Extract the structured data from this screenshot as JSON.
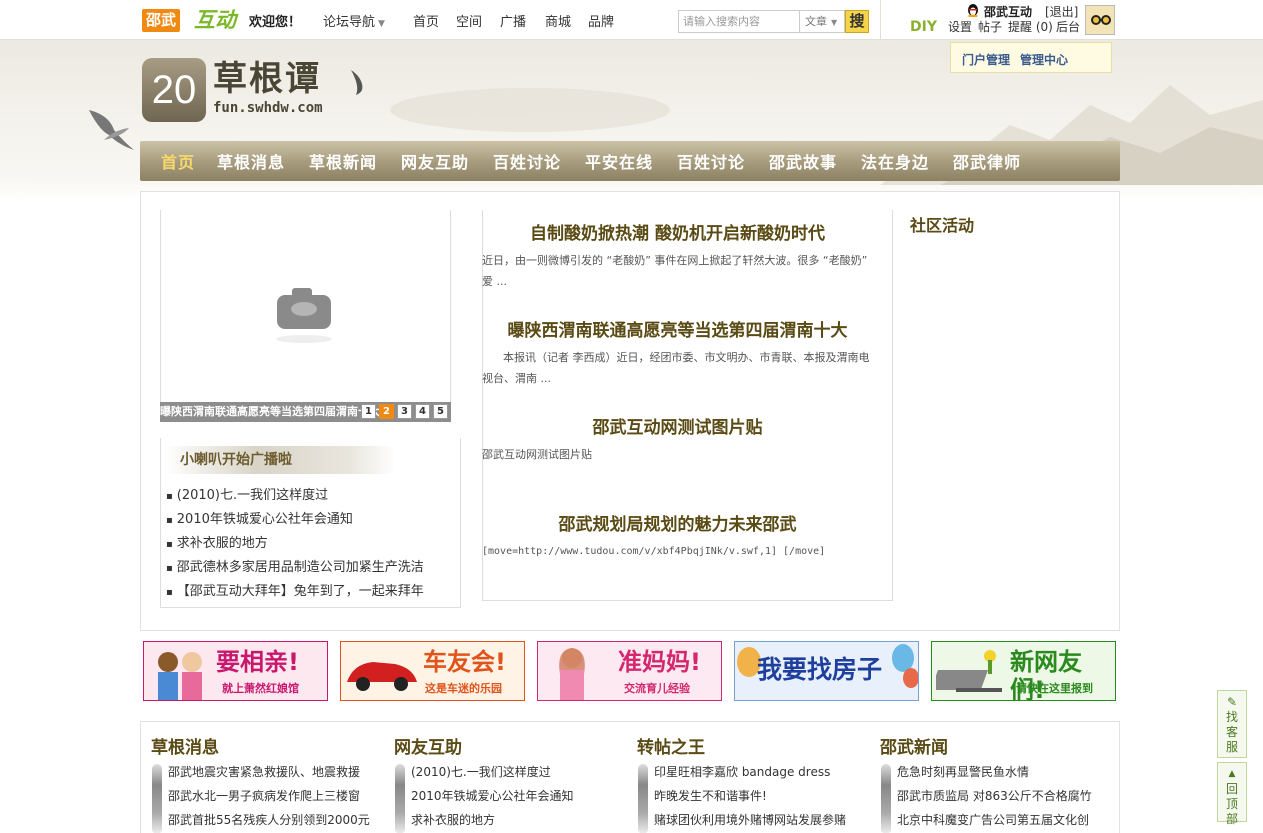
{
  "topbar": {
    "logo_a": "邵武",
    "logo_b": "互动",
    "welcome": "欢迎您！",
    "forum_nav": "论坛导航",
    "links": [
      "首页",
      "空间",
      "广播",
      "商城",
      "品牌"
    ],
    "search_placeholder": "请输入搜索内容",
    "search_type": "文章",
    "search_btn": "搜",
    "diy": "DIY",
    "username": "邵武互动",
    "logout": "[退出]",
    "user_links": [
      "设置",
      "帖子",
      "提醒 (0)",
      "后台"
    ]
  },
  "admin_popup": [
    "门户管理",
    "管理中心"
  ],
  "site": {
    "badge": "20",
    "name": "草根谭",
    "url": "fun.swhdw.com"
  },
  "nav": [
    "首页",
    "草根消息",
    "草根新闻",
    "网友互助",
    "百姓讨论",
    "平安在线",
    "百姓讨论",
    "邵武故事",
    "法在身边",
    "邵武律师"
  ],
  "slider": {
    "caption": "曝陕西渭南联通高愿亮等当选第四届渭南十大",
    "pages": [
      "1",
      "2",
      "3",
      "4",
      "5"
    ],
    "active_page": 2
  },
  "broadcast": {
    "title": "小喇叭开始广播啦",
    "items": [
      "(2010)七.一我们这样度过",
      "2010年铁城爱心公社年会通知",
      "求补衣服的地方",
      "邵武德林多家居用品制造公司加紧生产洗洁",
      "【邵武互动大拜年】兔年到了，一起来拜年"
    ]
  },
  "articles": [
    {
      "title": "自制酸奶掀热潮 酸奶机开启新酸奶时代",
      "summary": "近日，由一则微博引发的 “老酸奶” 事件在网上掀起了轩然大波。很多 “老酸奶” 爱 ..."
    },
    {
      "title": "曝陕西渭南联通高愿亮等当选第四届渭南十大",
      "summary": "      本报讯（记者 李西成）近日，经团市委、市文明办、市青联、本报及渭南电视台、渭南 ..."
    },
    {
      "title": "邵武互动网测试图片贴",
      "summary": "邵武互动网测试图片贴"
    },
    {
      "title": "邵武规划局规划的魅力未来邵武",
      "summary": "[move=http://www.tudou.com/v/xbf4PbqjINk/v.swf,1] [/move]"
    }
  ],
  "sidebar_title": "社区活动",
  "banners": [
    {
      "title": "要相亲!",
      "sub": "就上萧然红娘馆",
      "color": "#c8186e",
      "bg": "#fde8ef"
    },
    {
      "title": "车友会!",
      "sub": "这是车迷的乐园",
      "color": "#e0541c",
      "bg": "#fff3e6"
    },
    {
      "title": "准妈妈!",
      "sub": "交流育儿经验",
      "color": "#d4286e",
      "bg": "#fde9f1"
    },
    {
      "title": "我要找房子",
      "sub": "",
      "color": "#1f3f9e",
      "bg": "#e8f1fb"
    },
    {
      "title": "新网友们!",
      "sub": "请快在这里报到",
      "color": "#2a8a1e",
      "bg": "#eef8e6"
    }
  ],
  "columns": [
    {
      "title": "草根消息",
      "items": [
        "邵武地震灾害紧急救援队、地震救援",
        "邵武水北一男子疯病发作爬上三楼窗",
        "邵武首批55名残疾人分别领到2000元"
      ]
    },
    {
      "title": "网友互助",
      "items": [
        "(2010)七.一我们这样度过",
        "2010年铁城爱心公社年会通知",
        "求补衣服的地方"
      ]
    },
    {
      "title": "转帖之王",
      "items": [
        "印星旺相李嘉欣 bandage dress",
        "昨晚发生不和谐事件!",
        "赌球团伙利用境外赌博网站发展参赌"
      ]
    },
    {
      "title": "邵武新闻",
      "items": [
        "危急时刻再显警民鱼水情",
        "邵武市质监局 对863公斤不合格腐竹",
        "北京中科魔变广告公司第五届文化创"
      ]
    }
  ],
  "side_buttons": [
    "找客服",
    "回顶部"
  ]
}
